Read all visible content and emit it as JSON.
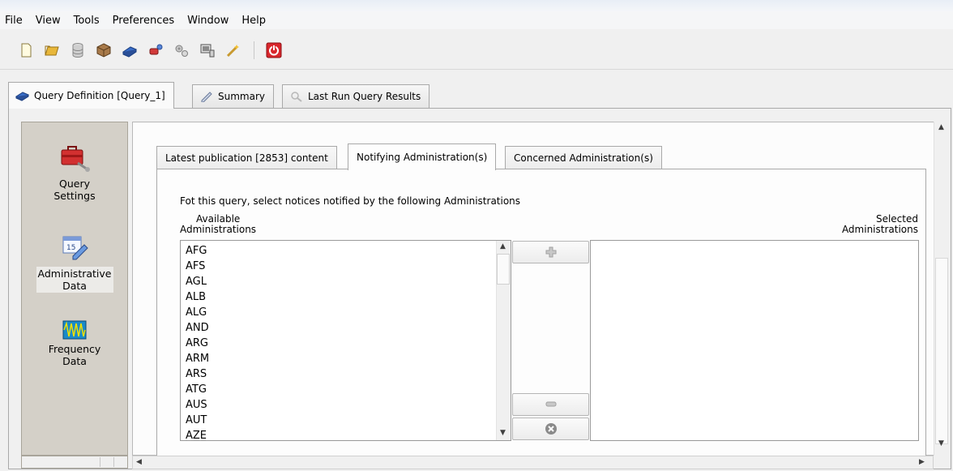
{
  "menu": [
    "File",
    "View",
    "Tools",
    "Preferences",
    "Window",
    "Help"
  ],
  "toolbar_icons": [
    "new-file-icon",
    "open-folder-icon",
    "database-icon",
    "package-icon",
    "query-icon",
    "connect-icon",
    "settings-icon",
    "monitor-icon",
    "wand-icon",
    "power-icon"
  ],
  "main_tabs": [
    {
      "label": "Query Definition [Query_1]",
      "icon": "query-icon"
    },
    {
      "label": "Summary",
      "icon": "pencil-icon"
    },
    {
      "label": "Last Run Query Results",
      "icon": "magnifier-icon"
    }
  ],
  "left_nav": [
    {
      "line1": "Query",
      "line2": "Settings",
      "icon": "toolbox-icon"
    },
    {
      "line1": "Administrative",
      "line2": "Data",
      "icon": "calendar-icon"
    },
    {
      "line1": "Frequency",
      "line2": "Data",
      "icon": "waveform-icon"
    }
  ],
  "inner_tabs": [
    {
      "label": "Latest publication [2853] content"
    },
    {
      "label": "Notifying Administration(s)"
    },
    {
      "label": "Concerned Administration(s)"
    }
  ],
  "instruction": "Fot this query, select notices notified by the following Administrations",
  "available": {
    "label_line1": "Available",
    "label_line2": "Administrations",
    "items": [
      "AFG",
      "AFS",
      "AGL",
      "ALB",
      "ALG",
      "AND",
      "ARG",
      "ARM",
      "ARS",
      "ATG",
      "AUS",
      "AUT",
      "AZE"
    ]
  },
  "selected": {
    "label_line1": "Selected",
    "label_line2": "Administrations",
    "items": []
  },
  "buttons": {
    "add": "plus-icon",
    "remove": "minus-icon",
    "clear": "clear-icon"
  },
  "colors": {
    "power_red": "#d9262c",
    "tab_border": "#a9a9a9",
    "nav_bg": "#d4d0c8"
  }
}
